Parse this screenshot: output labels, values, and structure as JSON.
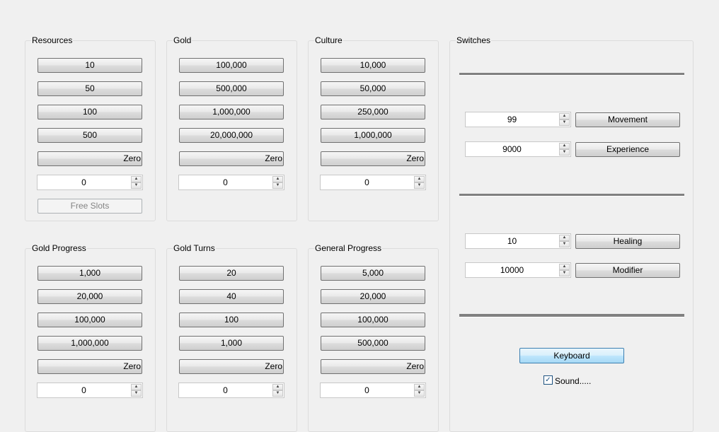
{
  "resources": {
    "title": "Resources",
    "buttons": [
      "10",
      "50",
      "100",
      "500"
    ],
    "zero": "Zero",
    "value": "0",
    "free_slots": "Free Slots"
  },
  "gold": {
    "title": "Gold",
    "buttons": [
      "100,000",
      "500,000",
      "1,000,000",
      "20,000,000"
    ],
    "zero": "Zero",
    "value": "0"
  },
  "culture": {
    "title": "Culture",
    "buttons": [
      "10,000",
      "50,000",
      "250,000",
      "1,000,000"
    ],
    "zero": "Zero",
    "value": "0"
  },
  "gold_progress": {
    "title": "Gold Progress",
    "buttons": [
      "1,000",
      "20,000",
      "100,000",
      "1,000,000"
    ],
    "zero": "Zero",
    "value": "0"
  },
  "gold_turns": {
    "title": "Gold Turns",
    "buttons": [
      "20",
      "40",
      "100",
      "1,000"
    ],
    "zero": "Zero",
    "value": "0"
  },
  "general_progress": {
    "title": "General Progress",
    "buttons": [
      "5,000",
      "20,000",
      "100,000",
      "500,000"
    ],
    "zero": "Zero",
    "value": "0"
  },
  "switches": {
    "title": "Switches",
    "movement_value": "99",
    "movement_label": "Movement",
    "experience_value": "9000",
    "experience_label": "Experience",
    "healing_value": "10",
    "healing_label": "Healing",
    "modifier_value": "10000",
    "modifier_label": "Modifier",
    "keyboard_label": "Keyboard",
    "sound_label": "Sound.....",
    "sound_checked": true,
    "check_mark": "✓"
  },
  "spin_up": "▲",
  "spin_down": "▼"
}
